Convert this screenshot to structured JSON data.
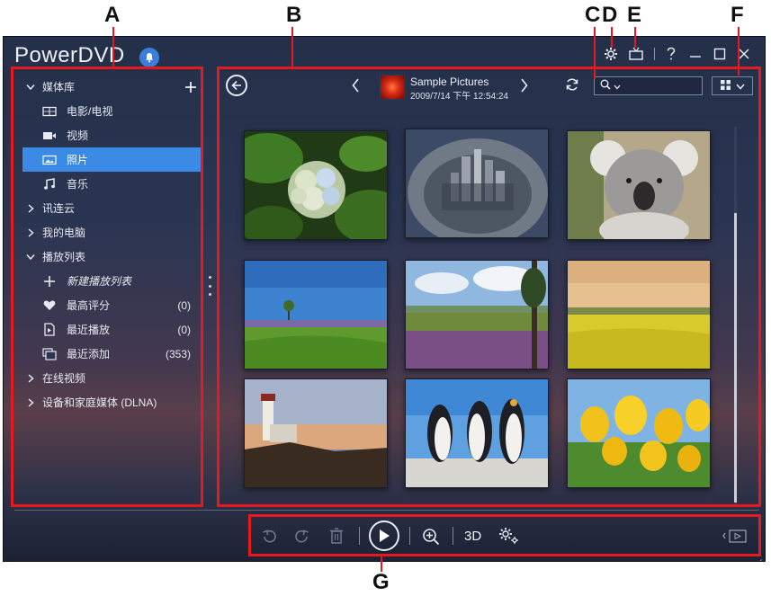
{
  "app": {
    "title": "PowerDVD"
  },
  "sidebar": {
    "media_library": "媒体库",
    "items": [
      {
        "label": "电影/电视",
        "icon": "film-icon"
      },
      {
        "label": "视频",
        "icon": "video-camera-icon"
      },
      {
        "label": "照片",
        "icon": "photo-icon",
        "selected": true
      },
      {
        "label": "音乐",
        "icon": "music-note-icon"
      }
    ],
    "cloud": "讯连云",
    "my_computer": "我的电脑",
    "playlists": "播放列表",
    "playlist_items": [
      {
        "label": "新建播放列表",
        "icon": "plus-icon",
        "count": ""
      },
      {
        "label": "最高评分",
        "icon": "heart-icon",
        "count": "(0)"
      },
      {
        "label": "最近播放",
        "icon": "recent-play-icon",
        "count": "(0)"
      },
      {
        "label": "最近添加",
        "icon": "recent-add-icon",
        "count": "(353)"
      }
    ],
    "online_video": "在线视频",
    "dlna": "设备和家庭媒体 (DLNA)"
  },
  "header": {
    "album_name": "Sample Pictures",
    "album_date": "2009/7/14 下午 12:54:24",
    "search_placeholder": ""
  },
  "photos": [
    {
      "name": "hydrangea-photo"
    },
    {
      "name": "city-fisheye-photo"
    },
    {
      "name": "koala-photo"
    },
    {
      "name": "lavender-field-photo"
    },
    {
      "name": "wildflower-meadow-photo"
    },
    {
      "name": "rapeseed-field-photo"
    },
    {
      "name": "lighthouse-photo"
    },
    {
      "name": "penguins-photo"
    },
    {
      "name": "yellow-tulips-photo"
    }
  ],
  "toolbar": {
    "three_d_label": "3D"
  },
  "callouts": {
    "a": "A",
    "b": "B",
    "c": "C",
    "d": "D",
    "e": "E",
    "f": "F",
    "g": "G"
  },
  "colors": {
    "accent": "#3b8be6",
    "callout": "#e8191e"
  }
}
